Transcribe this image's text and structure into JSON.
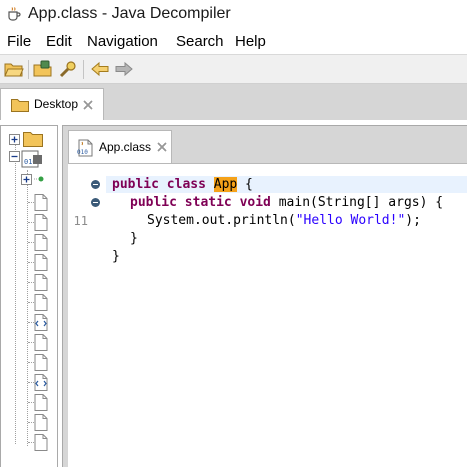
{
  "window": {
    "title": "App.class - Java Decompiler",
    "icon": "coffee-cup-icon"
  },
  "menu": {
    "items": [
      {
        "label": "File"
      },
      {
        "label": "Edit"
      },
      {
        "label": "Navigation"
      },
      {
        "label": "Search"
      },
      {
        "label": "Help"
      }
    ]
  },
  "toolbar": {
    "buttons": [
      "open-file-icon",
      "open-type-icon",
      "search-icon",
      "back-arrow-icon",
      "forward-arrow-icon"
    ]
  },
  "tabs": {
    "desktop": {
      "label": "Desktop",
      "icon": "folder-icon",
      "close_icon": "close-icon"
    },
    "editor": {
      "label": "App.class",
      "icon": "class-file-icon",
      "close_icon": "close-icon"
    }
  },
  "tree": {
    "nodes": [
      {
        "icon": "folder-icon",
        "expander": "+"
      },
      {
        "icon": "jar-icon",
        "expander": "-"
      },
      {
        "icon": "package-icon",
        "expander": "+"
      },
      {
        "icon": "file-icon"
      },
      {
        "icon": "file-icon"
      },
      {
        "icon": "file-icon"
      },
      {
        "icon": "file-icon"
      },
      {
        "icon": "file-icon"
      },
      {
        "icon": "file-icon"
      },
      {
        "icon": "xml-file-icon"
      },
      {
        "icon": "file-icon"
      },
      {
        "icon": "file-icon"
      },
      {
        "icon": "xml-file-icon"
      },
      {
        "icon": "file-icon"
      },
      {
        "icon": "file-icon"
      },
      {
        "icon": "file-icon"
      }
    ]
  },
  "code": {
    "line_number": "11",
    "line1": {
      "kw": "public class ",
      "name": "App",
      "rest": " {"
    },
    "line2": {
      "kw": "public static void",
      "rest": " main(String[] args) {"
    },
    "line3": {
      "pre": "System.out.println(",
      "str": "\"Hello World!\"",
      "post": ");"
    },
    "line4": "}",
    "line5": "}"
  },
  "colors": {
    "keyword": "#7f0055",
    "string": "#2a00ff",
    "highlight": "#f5a21a",
    "current_line": "#e8f2fe"
  }
}
